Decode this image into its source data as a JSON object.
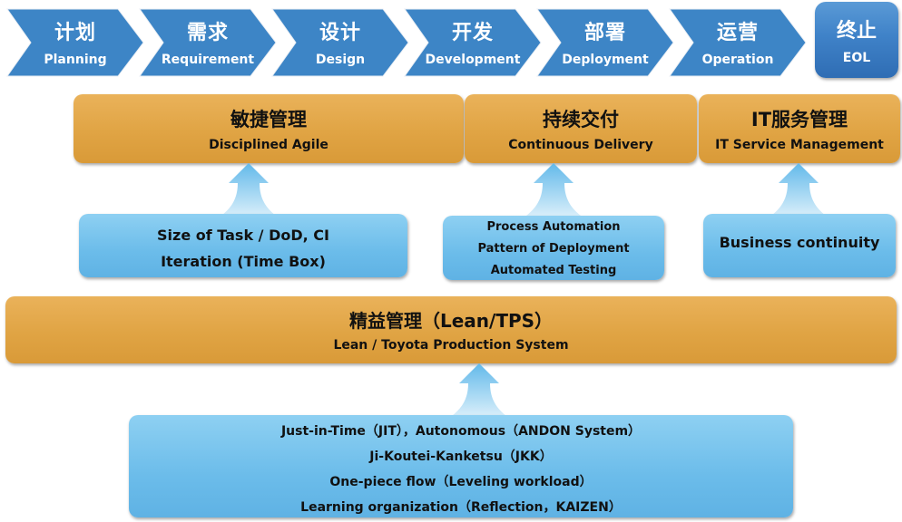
{
  "colors": {
    "chevron_blue": "#3d85c6",
    "eol_blue": "#3f82c8",
    "orange": "#e0a444",
    "light_blue": "#6bbcea",
    "text_dark": "#111111",
    "text_light": "#ffffff"
  },
  "lifecycle": [
    {
      "zh": "计划",
      "en": "Planning"
    },
    {
      "zh": "需求",
      "en": "Requirement"
    },
    {
      "zh": "设计",
      "en": "Design"
    },
    {
      "zh": "开发",
      "en": "Development"
    },
    {
      "zh": "部署",
      "en": "Deployment"
    },
    {
      "zh": "运营",
      "en": "Operation"
    }
  ],
  "eol": {
    "zh": "终止",
    "en": "EOL"
  },
  "practices": {
    "agile": {
      "zh": "敏捷管理",
      "en": "Disciplined Agile"
    },
    "cd": {
      "zh": "持续交付",
      "en": "Continuous Delivery"
    },
    "itsm": {
      "zh": "IT服务管理",
      "en": "IT Service Management"
    }
  },
  "enablers": {
    "agile": [
      "Size of Task / DoD, CI",
      "Iteration (Time Box)"
    ],
    "cd": [
      "Process Automation",
      "Pattern of Deployment",
      "Automated Testing"
    ],
    "itsm": [
      "Business continuity"
    ]
  },
  "lean": {
    "zh": "精益管理（Lean/TPS）",
    "en": "Lean / Toyota Production System"
  },
  "lean_foundations": [
    "Just-in-Time（JIT），Autonomous（ANDON System）",
    "Ji-Koutei-Kanketsu（JKK）",
    "One-piece flow（Leveling workload）",
    "Learning organization（Reflection，KAIZEN）"
  ]
}
